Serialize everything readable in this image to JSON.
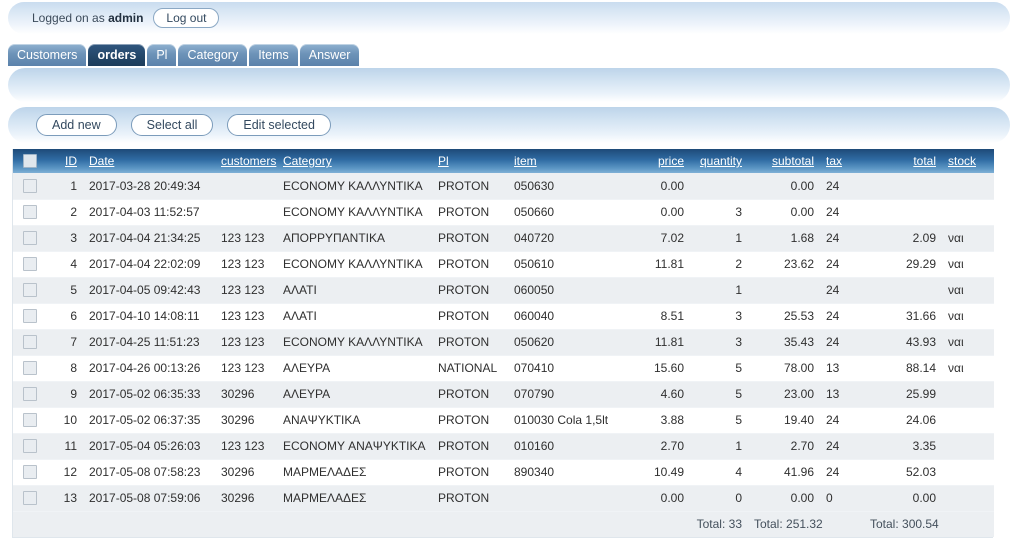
{
  "login": {
    "text_prefix": "Logged on as ",
    "user": "admin",
    "logout_label": "Log out"
  },
  "tabs": [
    {
      "label": "Customers",
      "active": false
    },
    {
      "label": "orders",
      "active": true
    },
    {
      "label": "Pl",
      "active": false
    },
    {
      "label": "Category",
      "active": false
    },
    {
      "label": "Items",
      "active": false
    },
    {
      "label": "Answer",
      "active": false
    }
  ],
  "toolbar": {
    "add_new_label": "Add new",
    "select_all_label": "Select all",
    "edit_selected_label": "Edit selected"
  },
  "grid": {
    "headers": {
      "checkbox": "",
      "id": "ID",
      "date": "Date",
      "customers": "customers",
      "category": "Category",
      "pl": "Pl",
      "item": "item",
      "price": "price",
      "quantity": "quantity",
      "subtotal": "subtotal",
      "tax": "tax",
      "total": "total",
      "stock": "stock"
    },
    "rows": [
      {
        "id": "1",
        "date": "2017-03-28 20:49:34",
        "customers": "",
        "category": "ECONOMY ΚΑΛΛΥΝΤΙΚΑ",
        "pl": "PROTON",
        "item": "050630",
        "price": "0.00",
        "quantity": "",
        "subtotal": "0.00",
        "tax": "24",
        "total": "",
        "stock": ""
      },
      {
        "id": "2",
        "date": "2017-04-03 11:52:57",
        "customers": "",
        "category": "ECONOMY ΚΑΛΛΥΝΤΙΚΑ",
        "pl": "PROTON",
        "item": "050660",
        "price": "0.00",
        "quantity": "3",
        "subtotal": "0.00",
        "tax": "24",
        "total": "",
        "stock": ""
      },
      {
        "id": "3",
        "date": "2017-04-04 21:34:25",
        "customers": "123 123",
        "category": "ΑΠΟΡΡΥΠΑΝΤΙΚΑ",
        "pl": "PROTON",
        "item": "040720",
        "price": "7.02",
        "quantity": "1",
        "subtotal": "1.68",
        "tax": "24",
        "total": "2.09",
        "stock": "ναι"
      },
      {
        "id": "4",
        "date": "2017-04-04 22:02:09",
        "customers": "123 123",
        "category": "ECONOMY ΚΑΛΛΥΝΤΙΚΑ",
        "pl": "PROTON",
        "item": "050610",
        "price": "11.81",
        "quantity": "2",
        "subtotal": "23.62",
        "tax": "24",
        "total": "29.29",
        "stock": "ναι"
      },
      {
        "id": "5",
        "date": "2017-04-05 09:42:43",
        "customers": "123 123",
        "category": "ΑΛΑΤΙ",
        "pl": "PROTON",
        "item": "060050",
        "price": "",
        "quantity": "1",
        "subtotal": "",
        "tax": "24",
        "total": "",
        "stock": "ναι"
      },
      {
        "id": "6",
        "date": "2017-04-10 14:08:11",
        "customers": "123 123",
        "category": "ΑΛΑΤΙ",
        "pl": "PROTON",
        "item": "060040",
        "price": "8.51",
        "quantity": "3",
        "subtotal": "25.53",
        "tax": "24",
        "total": "31.66",
        "stock": "ναι"
      },
      {
        "id": "7",
        "date": "2017-04-25 11:51:23",
        "customers": "123 123",
        "category": "ECONOMY ΚΑΛΛΥΝΤΙΚΑ",
        "pl": "PROTON",
        "item": "050620",
        "price": "11.81",
        "quantity": "3",
        "subtotal": "35.43",
        "tax": "24",
        "total": "43.93",
        "stock": "ναι"
      },
      {
        "id": "8",
        "date": "2017-04-26 00:13:26",
        "customers": "123 123",
        "category": "ΑΛΕΥΡΑ",
        "pl": "NATIONAL",
        "item": "070410",
        "price": "15.60",
        "quantity": "5",
        "subtotal": "78.00",
        "tax": "13",
        "total": "88.14",
        "stock": "ναι"
      },
      {
        "id": "9",
        "date": "2017-05-02 06:35:33",
        "customers": "30296",
        "category": "ΑΛΕΥΡΑ",
        "pl": "PROTON",
        "item": "070790",
        "price": "4.60",
        "quantity": "5",
        "subtotal": "23.00",
        "tax": "13",
        "total": "25.99",
        "stock": ""
      },
      {
        "id": "10",
        "date": "2017-05-02 06:37:35",
        "customers": "30296",
        "category": "ΑΝΑΨΥΚΤΙΚΑ",
        "pl": "PROTON",
        "item": "010030 Cola 1,5lt",
        "price": "3.88",
        "quantity": "5",
        "subtotal": "19.40",
        "tax": "24",
        "total": "24.06",
        "stock": ""
      },
      {
        "id": "11",
        "date": "2017-05-04 05:26:03",
        "customers": "123 123",
        "category": "ECONOMY ΑΝΑΨΥΚΤΙΚΑ",
        "pl": "PROTON",
        "item": "010160",
        "price": "2.70",
        "quantity": "1",
        "subtotal": "2.70",
        "tax": "24",
        "total": "3.35",
        "stock": ""
      },
      {
        "id": "12",
        "date": "2017-05-08 07:58:23",
        "customers": "30296",
        "category": "ΜΑΡΜΕΛΑΔΕΣ",
        "pl": "PROTON",
        "item": "890340",
        "price": "10.49",
        "quantity": "4",
        "subtotal": "41.96",
        "tax": "24",
        "total": "52.03",
        "stock": ""
      },
      {
        "id": "13",
        "date": "2017-05-08 07:59:06",
        "customers": "30296",
        "category": "ΜΑΡΜΕΛΑΔΕΣ",
        "pl": "PROTON",
        "item": "",
        "price": "0.00",
        "quantity": "0",
        "subtotal": "0.00",
        "tax": "0",
        "total": "0.00",
        "stock": ""
      }
    ],
    "footer": {
      "quantity_total": "Total: 33",
      "subtotal_total": "Total: 251.32",
      "total_total": "Total: 300.54"
    }
  }
}
